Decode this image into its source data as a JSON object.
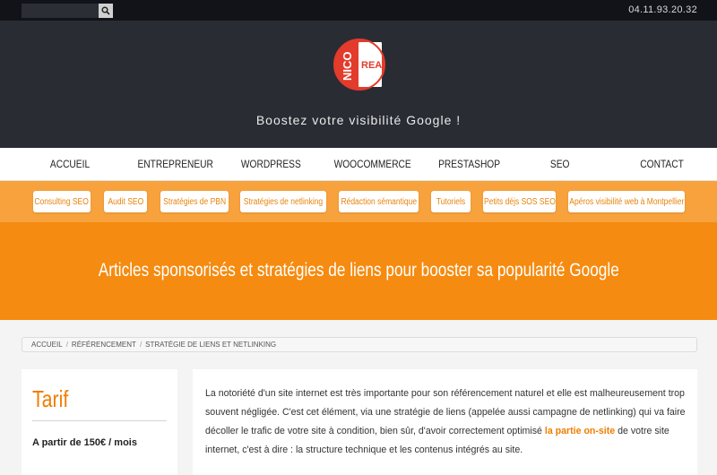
{
  "topbar": {
    "search_placeholder": "",
    "search_icon": "search-icon",
    "phone": "04.11.93.20.32"
  },
  "logo": {
    "line1": "NICO",
    "line2": "REA",
    "colors": {
      "red": "#e33b2c",
      "white": "#ffffff"
    }
  },
  "hero": {
    "tagline": "Boostez votre visibilité Google !"
  },
  "nav": {
    "items": [
      "ACCUEIL",
      "ENTREPRENEUR",
      "WORDPRESS",
      "WOOCOMMERCE",
      "PRESTASHOP",
      "SEO",
      "CONTACT"
    ]
  },
  "subnav": {
    "items": [
      "Consulting SEO",
      "Audit SEO",
      "Stratégies de PBN",
      "Stratégies de netlinking",
      "Rédaction sémantique",
      "Tutoriels",
      "Petits déjs SOS SEO",
      "Apéros visibilité web à Montpellier"
    ]
  },
  "banner": {
    "title": "Articles sponsorisés et stratégies de liens pour booster sa popularité Google"
  },
  "breadcrumb": {
    "items": [
      "Accueil",
      "Référencement",
      "Stratégie de liens et netlinking"
    ],
    "separator": "/"
  },
  "sidebar": {
    "title": "Tarif",
    "price": "A partir de 150€ / mois"
  },
  "article": {
    "text_before": "La notoriété d'un site internet est très importante pour son référencement naturel et elle est malheureusement trop souvent négligée. C'est cet élément, via une stratégie de liens (appelée aussi campagne de netlinking) qui va faire décoller le trafic de votre site à condition, bien sûr, d'avoir correctement optimisé ",
    "link_text": "la partie on-site",
    "text_after": " de votre site internet, c'est à dire : la structure technique et les contenus intégrés au site."
  },
  "colors": {
    "dark": "#2a2c34",
    "orange": "#f58b10",
    "orange_light": "#f7a23c",
    "link": "#f07d00"
  }
}
